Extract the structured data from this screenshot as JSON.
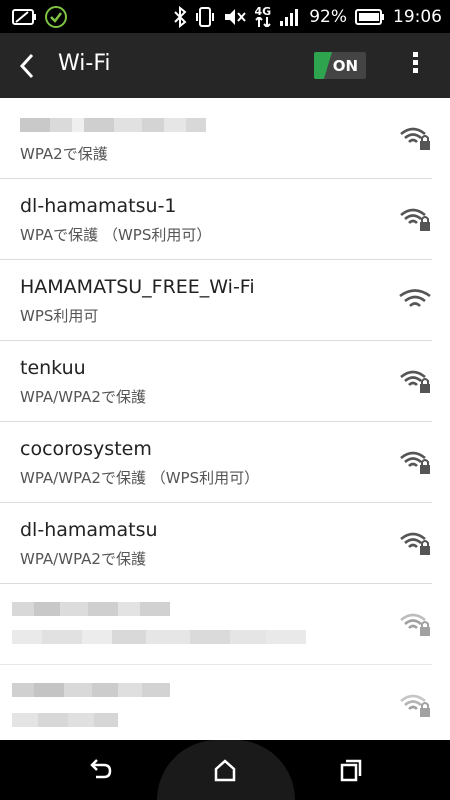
{
  "status_bar": {
    "battery_percent": "92%",
    "time": "19:06",
    "network": "4G"
  },
  "action_bar": {
    "title": "Wi-Fi",
    "toggle_label": "ON"
  },
  "networks": [
    {
      "ssid": "",
      "security": "WPA2で保護",
      "redacted_ssid": true,
      "locked": true
    },
    {
      "ssid": "dl-hamamatsu-1",
      "security": "WPAで保護 （WPS利用可）",
      "locked": true
    },
    {
      "ssid": "HAMAMATSU_FREE_Wi-Fi",
      "security": "WPS利用可",
      "locked": false
    },
    {
      "ssid": "tenkuu",
      "security": "WPA/WPA2で保護",
      "locked": true
    },
    {
      "ssid": "cocorosystem",
      "security": "WPA/WPA2で保護 （WPS利用可）",
      "locked": true
    },
    {
      "ssid": "dl-hamamatsu",
      "security": "WPA/WPA2で保護",
      "locked": true
    },
    {
      "ssid": "",
      "security": "",
      "redacted_ssid": true,
      "redacted_security": true,
      "locked": true
    },
    {
      "ssid": "",
      "security": "",
      "redacted_ssid": true,
      "redacted_security": true,
      "locked": true
    }
  ],
  "colors": {
    "action_bar": "#262626",
    "toggle_on": "#2ea44f",
    "status_bar": "#000000"
  },
  "nav_icons": [
    "back-icon",
    "home-icon",
    "recent-apps-icon"
  ]
}
